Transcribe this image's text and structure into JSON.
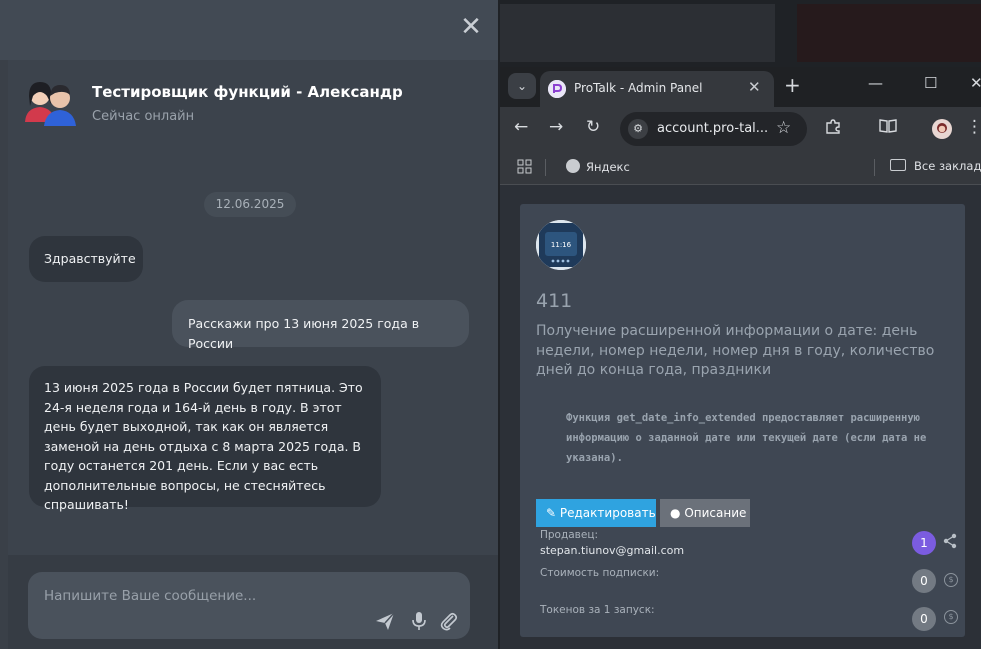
{
  "chat": {
    "title": "Тестировщик функций - Александр",
    "status": "Сейчас онлайн",
    "date": "12.06.2025",
    "messages": [
      {
        "from": "bot",
        "text": "Здравствуйте"
      },
      {
        "from": "user",
        "text": "Расскажи про 13 июня 2025 года в России"
      },
      {
        "from": "bot",
        "text": "13 июня 2025 года в России будет пятница. Это 24-я неделя года и 164-й день в году. В этот день будет выходной, так как он является заменой на день отдыха с 8 марта 2025 года. В году останется 201 день. Если у вас есть дополнительные вопросы, не стесняйтесь спрашивать!"
      }
    ],
    "input_placeholder": "Напишите Ваше сообщение...",
    "icons": [
      "close-icon",
      "send-icon",
      "microphone-icon",
      "attachment-icon"
    ]
  },
  "browser": {
    "tab_title": "ProTalk - Admin Panel",
    "url": "account.pro-tal...",
    "bookmarks": [
      "Яндекс",
      "Все закладки"
    ],
    "icons": [
      "tab-list-icon",
      "close-icon",
      "new-tab-icon",
      "minimize-icon",
      "maximize-icon",
      "back-icon",
      "forward-icon",
      "reload-icon",
      "site-info-icon",
      "star-icon",
      "extensions-icon",
      "reading-mode-icon",
      "profile-icon",
      "menu-icon",
      "apps-icon",
      "folder-icon"
    ]
  },
  "card": {
    "id": "411",
    "title": "Получение расширенной информации о дате: день недели, номер недели, номер дня в году, количество дней до конца года, праздники",
    "description": "Функция get_date_info_extended предоставляет расширенную информацию о заданной дате или текущей дате (если дата не указана).",
    "edit_label": "Редактировать",
    "info_label": "Описание",
    "seller_label": "Продавец:",
    "seller_email": "stepan.tiunov@gmail.com",
    "seller_count": "1",
    "subscription_label": "Стоимость подписки:",
    "subscription_value": "0",
    "tokens_label": "Токенов за 1 запуск:",
    "tokens_value": "0",
    "colors": {
      "edit_button": "#2fa3e0",
      "info_button": "#6b717a",
      "seller_badge": "#7b5ce0",
      "zero_badge": "#737a83"
    }
  }
}
